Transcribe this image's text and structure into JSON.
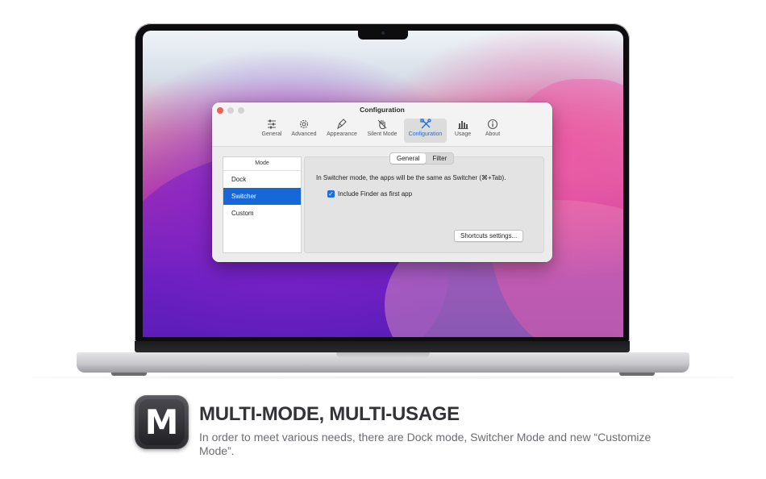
{
  "window": {
    "title": "Configuration",
    "toolbar": [
      {
        "label": "General",
        "icon": "sliders-icon"
      },
      {
        "label": "Advanced",
        "icon": "gear-icon"
      },
      {
        "label": "Appearance",
        "icon": "brush-icon"
      },
      {
        "label": "Silent Mode",
        "icon": "hand-icon"
      },
      {
        "label": "Configuration",
        "icon": "tools-icon",
        "active": true
      },
      {
        "label": "Usage",
        "icon": "bar-chart-icon"
      },
      {
        "label": "About",
        "icon": "info-icon"
      }
    ],
    "mode_list": {
      "header": "Mode",
      "items": [
        "Dock",
        "Switcher",
        "Custom"
      ],
      "selected": "Switcher"
    },
    "tabs": [
      "General",
      "Filter"
    ],
    "active_tab": "General",
    "description": "In Switcher mode, the apps will be the same as Switcher (⌘+Tab).",
    "checkbox": {
      "label": "Include Finder as first app",
      "checked": true
    },
    "shortcuts_button": "Shortcuts settings..."
  },
  "footer": {
    "app_icon_letter": "M",
    "headline": "MULTI-MODE, MULTI-USAGE",
    "description": "In order to meet various needs, there are Dock mode, Switcher Mode and new “Customize Mode”."
  },
  "colors": {
    "accent": "#1667d8",
    "close_button": "#ed5f57"
  }
}
